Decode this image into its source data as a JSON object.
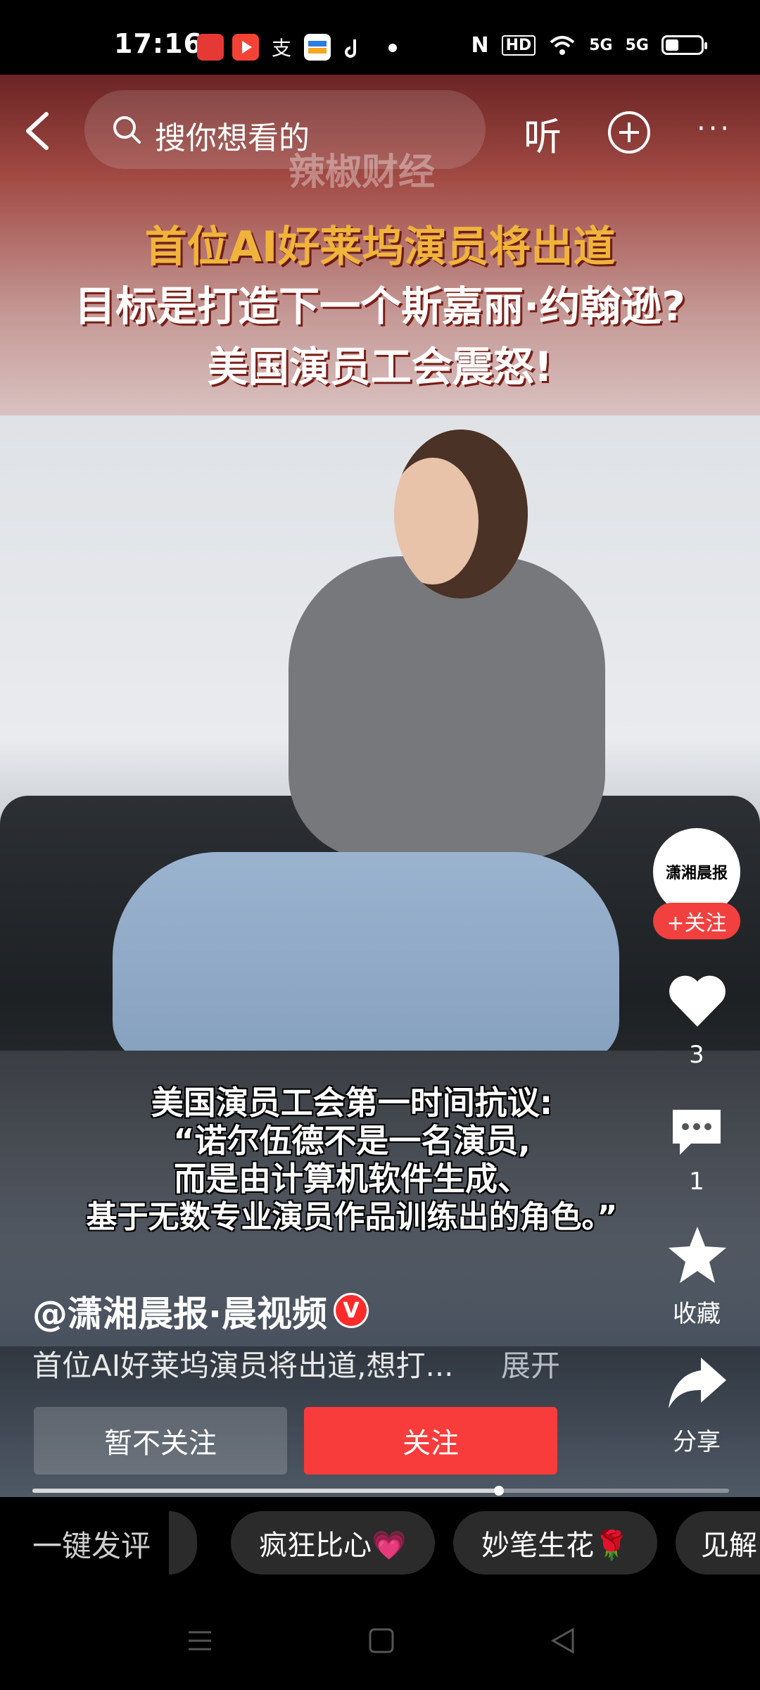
{
  "status_bar": {
    "time": "17:16",
    "app_icons": [
      "toutiao-icon",
      "video-play-icon",
      "alipay-icon",
      "wallet-icon",
      "tiktok-icon",
      "dot-icon"
    ],
    "right_icons": [
      "nfc-icon",
      "hd-icon",
      "wifi-icon",
      "signal-5g-icon",
      "signal-5g-icon",
      "battery-icon"
    ],
    "hd_label": "HD",
    "net1": "5G",
    "net2": "5G"
  },
  "top_bar": {
    "search_placeholder": "搜你想看的",
    "listen_label": "听",
    "more_label": "···"
  },
  "video": {
    "watermark": "辣椒财经",
    "banner_lines": [
      "首位AI好莱坞演员将出道",
      "目标是打造下一个斯嘉丽·约翰逊?",
      "美国演员工会震怒!"
    ],
    "subtitles": [
      "美国演员工会第一时间抗议:",
      "“诺尔伍德不是一名演员,",
      "而是由计算机软件生成、",
      "基于无数专业演员作品训练出的角色。”"
    ]
  },
  "right_rail": {
    "avatar_text": "潇湘晨报",
    "follow_chip": "+关注",
    "like_count": "3",
    "comment_count": "1",
    "favorite_label": "收藏",
    "share_label": "分享"
  },
  "author": {
    "name": "@潇湘晨报·晨视频",
    "verified_badge": "V",
    "description": "首位AI好莱坞演员将出道,想打...",
    "expand_label": "展开",
    "btn_nofollow": "暂不关注",
    "btn_follow": "关注",
    "progress": 0.67
  },
  "comment_chips": {
    "label": "一键发评",
    "chips": [
      "疯狂比心💗",
      "妙笔生花🌹",
      "见解"
    ]
  },
  "colors": {
    "accent_red": "#f73c3b",
    "banner_gold": "#f0b43a"
  }
}
